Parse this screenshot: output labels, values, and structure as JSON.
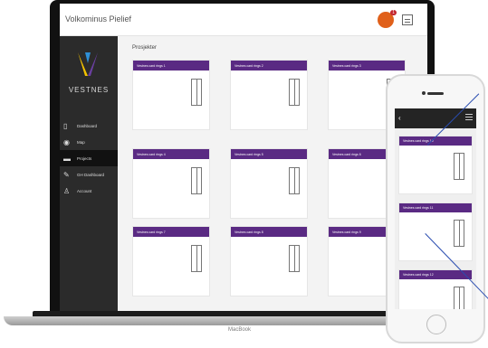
{
  "app": {
    "title": "Volkominus Pielief"
  },
  "header": {
    "notification_count": "1"
  },
  "brand": {
    "name": "VESTNES"
  },
  "sidebar": {
    "items": [
      {
        "label": "Dashboard",
        "icon": "document-icon",
        "active": false
      },
      {
        "label": "Map",
        "icon": "map-pin-icon",
        "active": false
      },
      {
        "label": "Projects",
        "icon": "folder-icon",
        "active": true
      },
      {
        "label": "GH Dashboard",
        "icon": "wrench-icon",
        "active": false
      },
      {
        "label": "Account",
        "icon": "user-icon",
        "active": false
      }
    ]
  },
  "main": {
    "title": "Prosjekter"
  },
  "cards": [
    {
      "title": "Vestnes card rings 1"
    },
    {
      "title": "Vestnes card rings 2"
    },
    {
      "title": "Vestnes card rings 3"
    },
    {
      "title": "Vestnes card rings 4"
    },
    {
      "title": "Vestnes card rings 5"
    },
    {
      "title": "Vestnes card rings 6"
    },
    {
      "title": "Vestnes card rings 7"
    },
    {
      "title": "Vestnes card rings 8"
    },
    {
      "title": "Vestnes card rings 9"
    }
  ],
  "phone": {
    "cards": [
      {
        "title": "Vestnes card rings 10"
      },
      {
        "title": "Vestnes card rings 11"
      },
      {
        "title": "Vestnes card rings 12"
      }
    ]
  },
  "laptop": {
    "brand_label": "MacBook"
  },
  "colors": {
    "accent": "#5a2a83",
    "sidebar": "#2b2b2b",
    "notification": "#e0601a"
  }
}
